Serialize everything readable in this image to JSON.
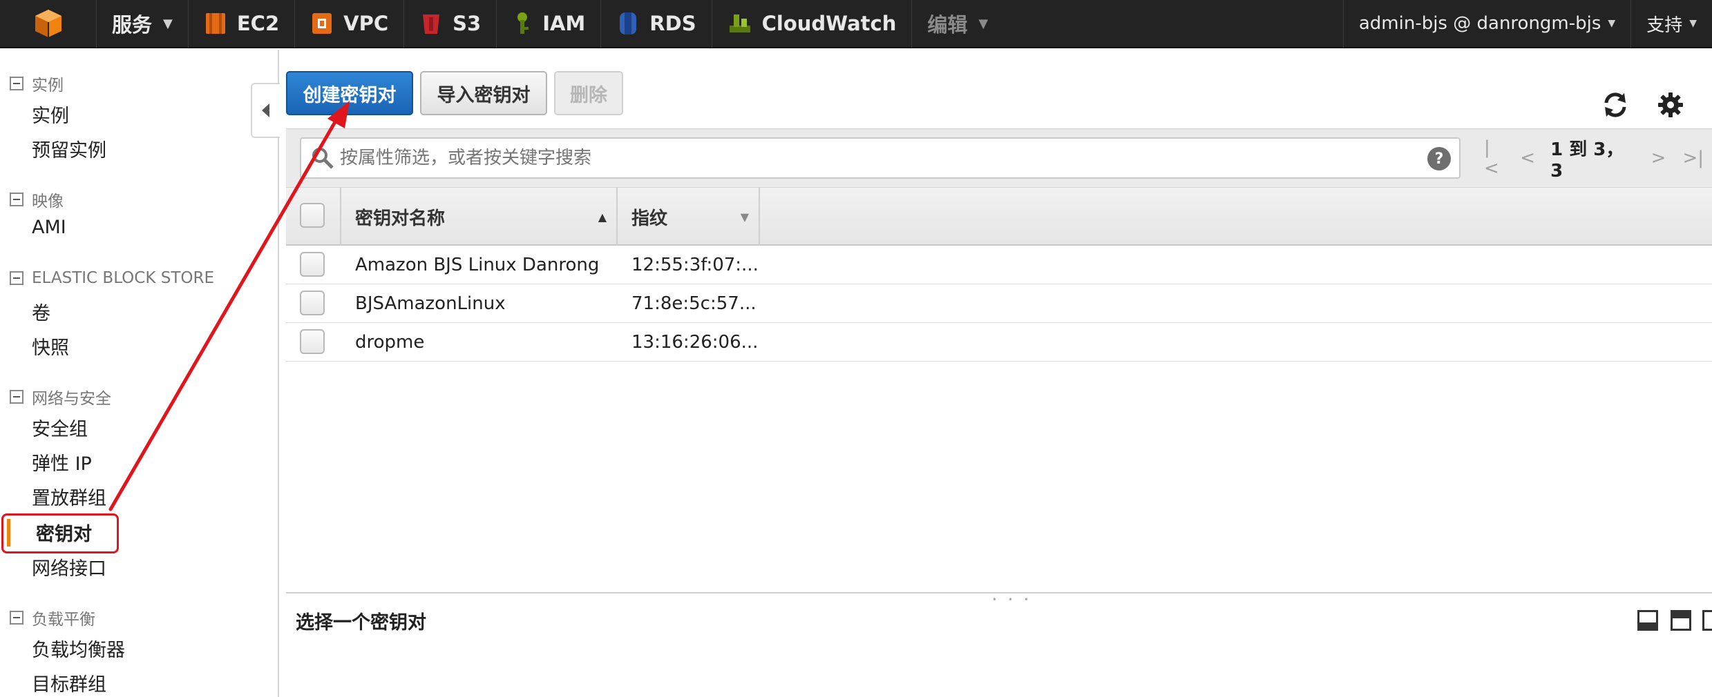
{
  "topbar": {
    "services_label": "服务",
    "nav": [
      {
        "label": "EC2",
        "icon": "ec2-icon"
      },
      {
        "label": "VPC",
        "icon": "vpc-icon"
      },
      {
        "label": "S3",
        "icon": "s3-icon"
      },
      {
        "label": "IAM",
        "icon": "iam-icon"
      },
      {
        "label": "RDS",
        "icon": "rds-icon"
      },
      {
        "label": "CloudWatch",
        "icon": "cloudwatch-icon"
      }
    ],
    "edit_label": "编辑",
    "account_label": "admin-bjs @ danrongm-bjs",
    "support_label": "支持",
    "colors": {
      "bg": "#232323",
      "logo": "#f0820f"
    }
  },
  "sidebar": {
    "groups": [
      {
        "title": "实例",
        "items": [
          "实例",
          "预留实例"
        ]
      },
      {
        "title": "映像",
        "items": [
          "AMI"
        ]
      },
      {
        "title": "ELASTIC BLOCK STORE",
        "items": [
          "卷",
          "快照"
        ]
      },
      {
        "title": "网络与安全",
        "items": [
          "安全组",
          "弹性 IP",
          "置放群组",
          "密钥对",
          "网络接口"
        ]
      },
      {
        "title": "负载平衡",
        "items": [
          "负载均衡器",
          "目标群组"
        ]
      }
    ],
    "active_item": "密钥对"
  },
  "toolbar": {
    "create_label": "创建密钥对",
    "import_label": "导入密钥对",
    "delete_label": "删除"
  },
  "filter": {
    "placeholder": "按属性筛选，或者按关键字搜索",
    "help_label": "?",
    "pagination": "1 到 3， 3"
  },
  "table": {
    "columns": [
      "密钥对名称",
      "指纹"
    ],
    "rows": [
      {
        "name": "Amazon BJS Linux Danrong",
        "fingerprint": "12:55:3f:07:..."
      },
      {
        "name": "BJSAmazonLinux",
        "fingerprint": "71:8e:5c:57..."
      },
      {
        "name": "dropme",
        "fingerprint": "13:16:26:06..."
      }
    ]
  },
  "detail": {
    "title": "选择一个密钥对"
  },
  "annotation_color": "#e0161c"
}
